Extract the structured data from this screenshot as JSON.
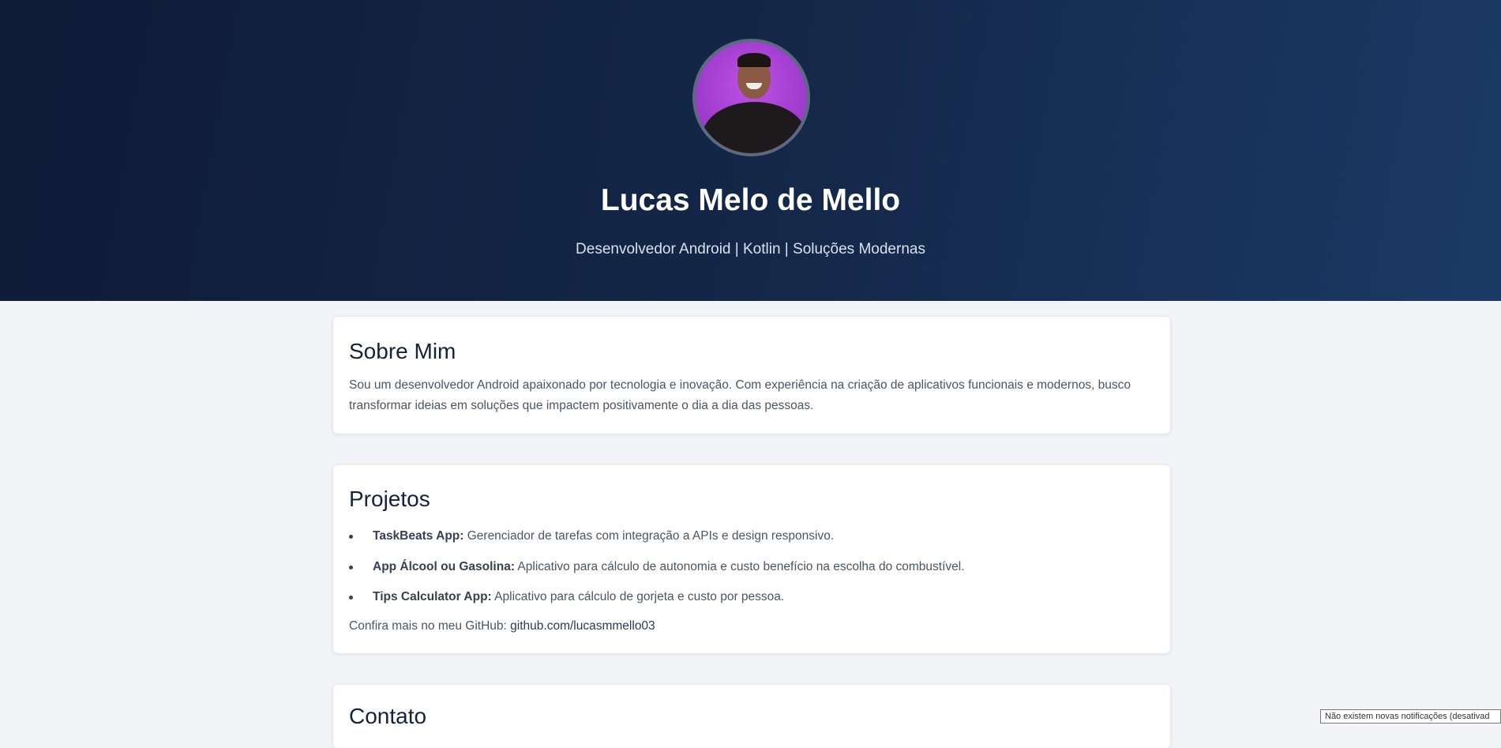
{
  "profile": {
    "name": "Lucas Melo de Mello",
    "tagline": "Desenvolvedor Android | Kotlin | Soluções Modernas"
  },
  "about": {
    "title": "Sobre Mim",
    "text": "Sou um desenvolvedor Android apaixonado por tecnologia e inovação. Com experiência na criação de aplicativos funcionais e modernos, busco transformar ideias em soluções que impactem positivamente o dia a dia das pessoas."
  },
  "projects": {
    "title": "Projetos",
    "items": [
      {
        "name": "TaskBeats App:",
        "description": " Gerenciador de tarefas com integração a APIs e design responsivo."
      },
      {
        "name": "App Álcool ou Gasolina:",
        "description": " Aplicativo para cálculo de autonomia e custo benefício na escolha do combustível."
      },
      {
        "name": "Tips Calculator App:",
        "description": " Aplicativo para cálculo de gorjeta e custo por pessoa."
      }
    ],
    "more_prefix": "Confira mais no meu GitHub: ",
    "github_link": "github.com/lucasmmello03"
  },
  "contact": {
    "title": "Contato"
  },
  "notification": {
    "text": "Não existem novas notificações (desativad"
  },
  "colors": {
    "hero_start": "#0f1b37",
    "hero_end": "#1b3a66",
    "avatar_bg": "#a23ed0",
    "page_bg": "#f3f4f8"
  }
}
